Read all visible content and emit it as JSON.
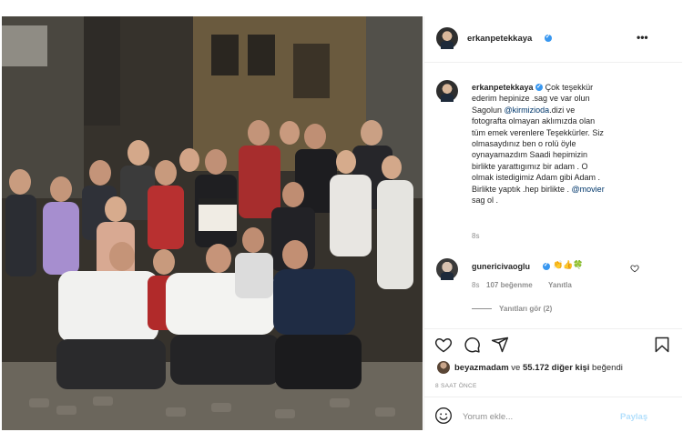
{
  "post": {
    "author": "erkanpetekkaya",
    "caption_user": "erkanpetekkaya",
    "caption_lines": [
      "Çok teşekkür",
      "ederim hepinize .sag ve var olun",
      "Sagolun ",
      "fotografta olmayan aklımızda olan",
      "tüm emek verenlere Teşekkürler. Siz",
      "olmasaydınız ben o rolü öyle",
      "oynayamazdım Saadi hepimizin",
      "birlikte yarattıgımız bir adam . O",
      "olmak istedigimiz Adam gibi Adam .",
      "Birlikte yaptık .hep birlikte . ",
      "sag ol ."
    ],
    "mention_kirmizi": "@kirmizioda",
    "after_mention": ".dizi ve",
    "mention_movier": "@movier",
    "caption_time": "8s"
  },
  "comment": {
    "user": "gunericivaoglu",
    "emojis": "👏👍🍀",
    "time": "8s",
    "likes": "107 beğenme",
    "reply_label": "Yanıtla",
    "view_replies": "Yanıtları gör (2)"
  },
  "likes": {
    "first_user": "beyazmadam",
    "connector": " ve ",
    "others": "55.172 diğer kişi",
    "suffix": " beğendi"
  },
  "timestamp": "8 SAAT ÖNCE",
  "composer": {
    "placeholder": "Yorum ekle...",
    "post_label": "Paylaş"
  },
  "icons": {
    "more": "more-icon",
    "heart": "heart-icon",
    "comment": "comment-icon",
    "share": "share-icon",
    "save": "bookmark-icon",
    "emoji": "smile-icon",
    "verified": "verified-icon"
  },
  "colors": {
    "verified": "#3897f0",
    "mention": "#00376b",
    "muted": "#8e8e8e",
    "post_disabled": "#b2dffc"
  }
}
